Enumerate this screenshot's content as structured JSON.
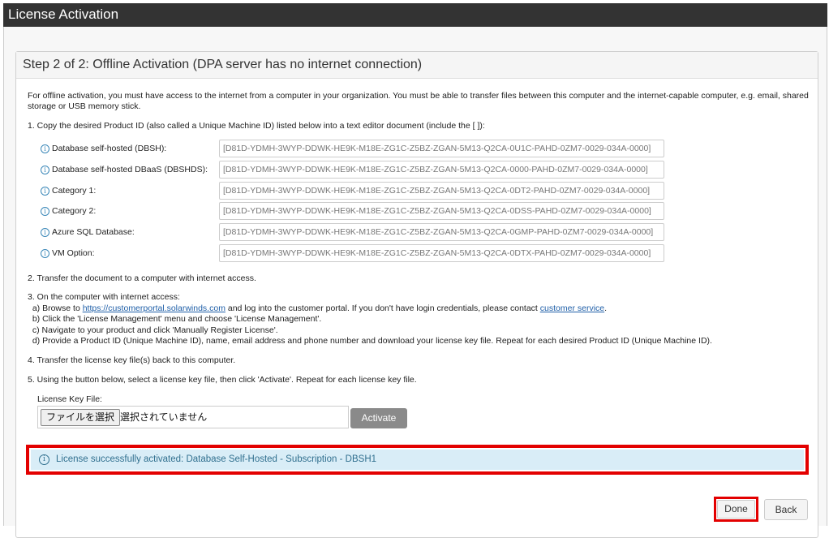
{
  "window": {
    "title": "License Activation"
  },
  "panel": {
    "heading": "Step 2 of 2: Offline Activation (DPA server has no internet connection)"
  },
  "intro": "For offline activation, you must have access to the internet from a computer in your organization. You must be able to transfer files between this computer and the internet-capable computer, e.g. email, shared storage or USB memory stick.",
  "step1": "1. Copy the desired Product ID (also called a Unique Machine ID) listed below into a text editor document (include the [ ]):",
  "products": [
    {
      "label": "Database self-hosted (DBSH):",
      "id": "[D81D-YDMH-3WYP-DDWK-HE9K-M18E-ZG1C-Z5BZ-ZGAN-5M13-Q2CA-0U1C-PAHD-0ZM7-0029-034A-0000]"
    },
    {
      "label": "Database self-hosted DBaaS (DBSHDS):",
      "id": "[D81D-YDMH-3WYP-DDWK-HE9K-M18E-ZG1C-Z5BZ-ZGAN-5M13-Q2CA-0000-PAHD-0ZM7-0029-034A-0000]"
    },
    {
      "label": "Category 1:",
      "id": "[D81D-YDMH-3WYP-DDWK-HE9K-M18E-ZG1C-Z5BZ-ZGAN-5M13-Q2CA-0DT2-PAHD-0ZM7-0029-034A-0000]"
    },
    {
      "label": "Category 2:",
      "id": "[D81D-YDMH-3WYP-DDWK-HE9K-M18E-ZG1C-Z5BZ-ZGAN-5M13-Q2CA-0DSS-PAHD-0ZM7-0029-034A-0000]"
    },
    {
      "label": "Azure SQL Database:",
      "id": "[D81D-YDMH-3WYP-DDWK-HE9K-M18E-ZG1C-Z5BZ-ZGAN-5M13-Q2CA-0GMP-PAHD-0ZM7-0029-034A-0000]"
    },
    {
      "label": "VM Option:",
      "id": "[D81D-YDMH-3WYP-DDWK-HE9K-M18E-ZG1C-Z5BZ-ZGAN-5M13-Q2CA-0DTX-PAHD-0ZM7-0029-034A-0000]"
    }
  ],
  "info_icon_glyph": "i",
  "step2": "2. Transfer the document to a computer with internet access.",
  "step3": {
    "title": "3. On the computer with internet access:",
    "a_prefix": "a) Browse to ",
    "a_link": "https://customerportal.solarwinds.com",
    "a_middle": " and log into the customer portal. If you don't have login credentials, please contact ",
    "a_link2": "customer service",
    "a_suffix": ".",
    "b": "b) Click the 'License Management' menu and choose 'License Management'.",
    "c": "c) Navigate to your product and click 'Manually Register License'.",
    "d": "d) Provide a Product ID (Unique Machine ID), name, email address and phone number and download your license key file. Repeat for each desired Product ID (Unique Machine ID)."
  },
  "step4": "4. Transfer the license key file(s) back to this computer.",
  "step5": "5. Using the button below, select a license key file, then click 'Activate'. Repeat for each license key file.",
  "license_file": {
    "label": "License Key File:",
    "choose_button": "ファイルを選択",
    "status": "選択されていません"
  },
  "activate_button": "Activate",
  "alert": "License successfully activated: Database Self-Hosted - Subscription - DBSH1",
  "done_button": "Done",
  "back_button": "Back",
  "colors": {
    "highlight": "#e30000",
    "alert_bg": "#d9edf7",
    "alert_text": "#31708f",
    "link": "#1f5fa8"
  }
}
